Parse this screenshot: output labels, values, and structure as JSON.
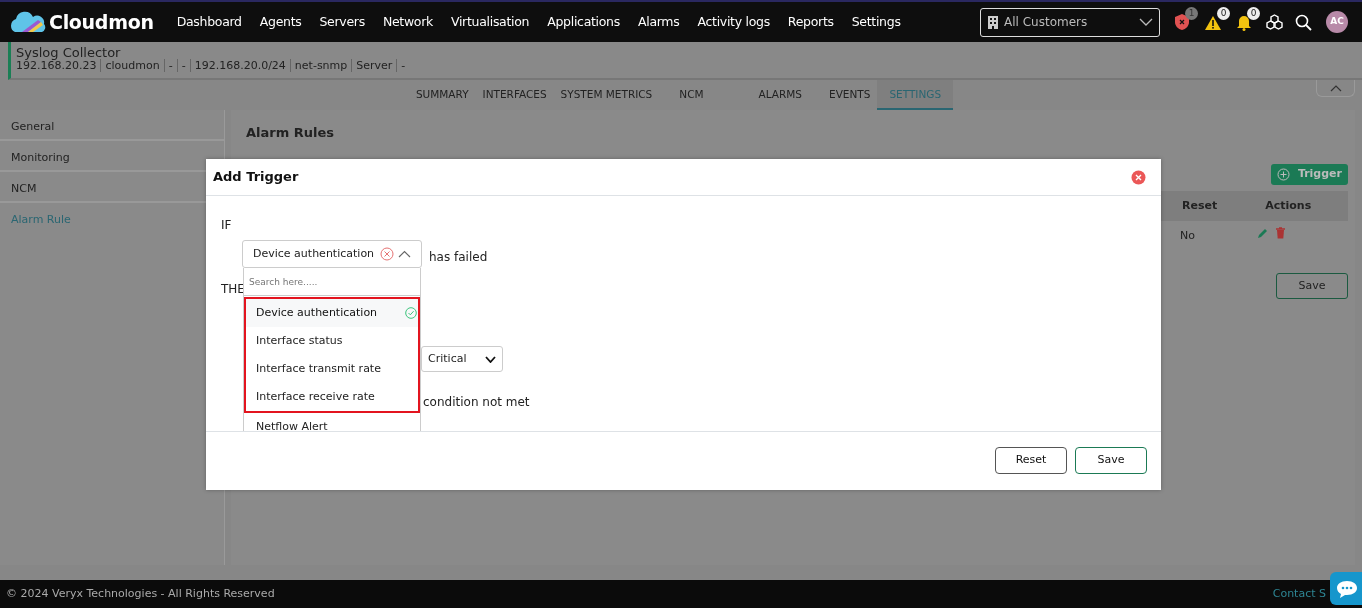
{
  "navbar": {
    "brand": "Cloudmon",
    "menu": [
      {
        "label": "Dashboard"
      },
      {
        "label": "Agents"
      },
      {
        "label": "Servers"
      },
      {
        "label": "Network"
      },
      {
        "label": "Virtualisation"
      },
      {
        "label": "Applications"
      },
      {
        "label": "Alarms"
      },
      {
        "label": "Activity logs"
      },
      {
        "label": "Reports"
      },
      {
        "label": "Settings"
      }
    ],
    "customer_select": {
      "value": "All Customers"
    },
    "security_count": "1",
    "warning_count": "0",
    "notification_count": "0",
    "avatar": "AC"
  },
  "device": {
    "name": "Syslog Collector",
    "details": [
      "192.168.20.23",
      "cloudmon",
      "-",
      "-",
      "192.168.20.0/24",
      "net-snmp",
      "Server",
      "-"
    ]
  },
  "tabs": [
    {
      "label": "SUMMARY",
      "selected": false
    },
    {
      "label": "INTERFACES",
      "selected": false
    },
    {
      "label": "SYSTEM METRICS",
      "selected": false
    },
    {
      "label": "NCM",
      "selected": false
    },
    {
      "label": "ALARMS",
      "selected": false
    },
    {
      "label": "EVENTS",
      "selected": false
    },
    {
      "label": "SETTINGS",
      "selected": true
    }
  ],
  "sidebar": {
    "items": [
      {
        "label": "General",
        "selected": false
      },
      {
        "label": "Monitoring",
        "selected": false
      },
      {
        "label": "NCM",
        "selected": false
      },
      {
        "label": "Alarm Rule",
        "selected": true
      }
    ]
  },
  "page": {
    "title": "Alarm Rules",
    "add_button": "Trigger",
    "table": {
      "columns": [
        "Reset",
        "Actions"
      ],
      "rows": [
        {
          "reset": "No"
        }
      ]
    },
    "save_button": "Save"
  },
  "modal": {
    "title": "Add Trigger",
    "if_label": "IF",
    "condition": {
      "value": "Device authentication",
      "expanded": true,
      "search_placeholder": "Search here.....",
      "options": [
        {
          "label": "Device authentication",
          "selected": true,
          "highlighted": true
        },
        {
          "label": "Interface status",
          "selected": false,
          "highlighted": true
        },
        {
          "label": "Interface transmit rate",
          "selected": false,
          "highlighted": true
        },
        {
          "label": "Interface receive rate",
          "selected": false,
          "highlighted": true
        },
        {
          "label": "Netflow Alert",
          "selected": false,
          "highlighted": false
        }
      ]
    },
    "condition_suffix": "has failed",
    "then_label": "THE",
    "severity": {
      "value": "Critical"
    },
    "condition_not_met": "condition not met",
    "buttons": {
      "reset": "Reset",
      "save": "Save"
    }
  },
  "footer": {
    "copyright": "© 2024 Veryx Technologies - All Rights Reserved",
    "contact": "Contact S"
  }
}
